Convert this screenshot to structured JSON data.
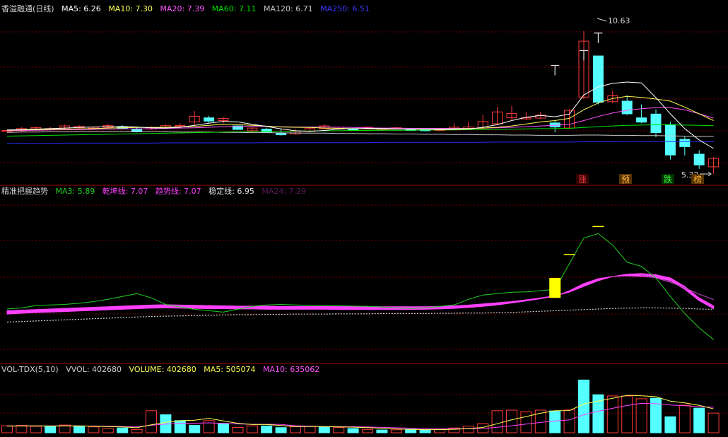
{
  "colors": {
    "up": "#ff3a3a",
    "down": "#54ffff",
    "grid": "#7a0000",
    "divider": "#a00000",
    "ma5": "#ffffff",
    "ma10": "#ffff54",
    "ma20": "#ff54ff",
    "ma60": "#00e400",
    "ma120": "#c8c8c8",
    "ma250": "#2a2aff",
    "white": "#d0d0d0",
    "yellow": "#ffff00",
    "magenta": "#ff40ff",
    "green": "#20d020",
    "purple": "#b040b0"
  },
  "price_header": {
    "name": "香溢融通(日线)",
    "ma5": "MA5: 6.26",
    "ma10": "MA10: 7.30",
    "ma20": "MA20: 7.39",
    "ma60": "MA60: 7.11",
    "ma120": "MA120: 6.71",
    "ma250": "MA250: 6.51"
  },
  "ind_header": {
    "name": "精准把握趋势",
    "ma3": "MA3: 5.89",
    "qk": "乾坤线: 7.07",
    "qs": "趋势线: 7.07",
    "wd": "稳定线: 6.95",
    "ma24": "MA24: 7.29"
  },
  "vol_header": {
    "name": "VOL-TDX(5,10)",
    "vvol": "VVOL: 402680",
    "volume": "VOLUME: 402680",
    "ma5": "MA5: 505074",
    "ma10": "MA10: 635062"
  },
  "annotations": {
    "high_label": "10.63",
    "low_label": "5.32",
    "tag_zhang": "涨",
    "tag_yu": "预",
    "tag_die": "跌",
    "tag_bang": "榜"
  },
  "chart_data": [
    {
      "type": "candlestick",
      "title": "香溢融通(日线)",
      "ylim": [
        5.0,
        11.2
      ],
      "x": [
        1,
        2,
        3,
        4,
        5,
        6,
        7,
        8,
        9,
        10,
        11,
        12,
        13,
        14,
        15,
        16,
        17,
        18,
        19,
        20,
        21,
        22,
        23,
        24,
        25,
        26,
        27,
        28,
        29,
        30,
        31,
        32,
        33,
        34,
        35,
        36,
        37,
        38,
        39,
        40,
        41,
        42,
        43,
        44,
        45,
        46,
        47,
        48,
        49,
        50
      ],
      "open": [
        6.92,
        6.92,
        6.99,
        6.97,
        7.02,
        7.03,
        7.02,
        7.05,
        7.05,
        6.98,
        6.99,
        7.05,
        7.08,
        7.25,
        7.4,
        7.3,
        7.1,
        6.92,
        6.98,
        6.84,
        6.8,
        6.9,
        7.0,
        7.03,
        6.98,
        7.0,
        6.95,
        7.0,
        6.98,
        6.97,
        6.93,
        6.98,
        6.99,
        7.02,
        7.18,
        7.4,
        7.36,
        7.39,
        7.21,
        7.02,
        8.17,
        9.7,
        8.0,
        8.02,
        7.4,
        7.54,
        7.15,
        6.6,
        6.05,
        5.58
      ],
      "close": [
        6.93,
        7.0,
        7.04,
        7.0,
        7.1,
        7.09,
        7.05,
        7.11,
        7.03,
        6.88,
        7.04,
        7.11,
        7.12,
        7.46,
        7.28,
        7.38,
        6.97,
        7.02,
        6.86,
        6.77,
        6.9,
        7.0,
        7.1,
        7.05,
        6.95,
        7.05,
        6.98,
        7.03,
        6.93,
        6.92,
        6.98,
        7.05,
        7.06,
        7.26,
        7.62,
        7.56,
        7.4,
        7.5,
        7.06,
        7.68,
        10.25,
        7.98,
        8.22,
        7.55,
        7.24,
        6.85,
        6.02,
        6.33,
        5.65,
        5.89
      ],
      "high": [
        6.96,
        7.05,
        7.08,
        7.06,
        7.15,
        7.13,
        7.07,
        7.18,
        7.12,
        7.05,
        7.09,
        7.16,
        7.2,
        7.65,
        7.48,
        7.43,
        7.12,
        7.05,
        7.03,
        7.0,
        6.98,
        7.05,
        7.18,
        7.07,
        7.01,
        7.08,
        7.01,
        7.06,
        7.0,
        7.0,
        7.0,
        7.2,
        7.25,
        7.5,
        7.8,
        7.84,
        7.62,
        7.63,
        7.3,
        7.72,
        10.63,
        8.42,
        8.4,
        8.24,
        7.9,
        7.71,
        7.25,
        6.7,
        6.2,
        5.95
      ],
      "low": [
        6.9,
        6.88,
        6.97,
        6.95,
        6.99,
        7.01,
        6.98,
        7.0,
        6.98,
        6.86,
        6.95,
        7.02,
        7.06,
        7.1,
        7.2,
        7.2,
        6.95,
        6.84,
        6.84,
        6.74,
        6.78,
        6.86,
        6.98,
        6.98,
        6.93,
        6.97,
        6.92,
        6.98,
        6.9,
        6.89,
        6.9,
        6.95,
        6.96,
        7.0,
        7.15,
        7.3,
        7.33,
        7.37,
        6.86,
        7.0,
        8.1,
        7.9,
        7.95,
        7.5,
        7.2,
        6.68,
        5.85,
        6.0,
        5.5,
        5.32
      ],
      "ma5": [
        6.95,
        6.96,
        6.98,
        7.0,
        7.02,
        7.04,
        7.06,
        7.07,
        7.08,
        7.06,
        7.03,
        7.02,
        7.05,
        7.12,
        7.2,
        7.27,
        7.25,
        7.16,
        7.08,
        6.99,
        6.92,
        6.9,
        6.93,
        6.98,
        7.0,
        7.01,
        7.0,
        6.99,
        6.98,
        6.98,
        6.96,
        6.97,
        6.98,
        7.05,
        7.15,
        7.3,
        7.42,
        7.49,
        7.44,
        7.54,
        8.25,
        8.55,
        8.68,
        8.73,
        8.7,
        8.15,
        7.55,
        7.0,
        6.58,
        6.26
      ],
      "ma10": [
        6.94,
        6.95,
        6.96,
        6.97,
        6.98,
        6.99,
        7.0,
        7.02,
        7.03,
        7.04,
        7.04,
        7.05,
        7.06,
        7.08,
        7.12,
        7.16,
        7.15,
        7.12,
        7.09,
        7.06,
        7.05,
        7.04,
        7.02,
        7.01,
        7.0,
        6.99,
        6.98,
        6.98,
        6.98,
        6.98,
        6.98,
        6.99,
        7.0,
        7.02,
        7.05,
        7.1,
        7.17,
        7.25,
        7.3,
        7.38,
        7.7,
        7.95,
        8.12,
        8.2,
        8.16,
        8.1,
        8.02,
        7.8,
        7.55,
        7.3
      ],
      "ma20": [
        6.92,
        6.93,
        6.94,
        6.95,
        6.96,
        6.96,
        6.97,
        6.98,
        6.99,
        6.99,
        7.0,
        7.01,
        7.02,
        7.03,
        7.05,
        7.07,
        7.08,
        7.08,
        7.08,
        7.07,
        7.06,
        7.06,
        7.06,
        7.05,
        7.04,
        7.03,
        7.02,
        7.02,
        7.01,
        7.01,
        7.01,
        7.01,
        7.01,
        7.02,
        7.03,
        7.05,
        7.07,
        7.1,
        7.12,
        7.16,
        7.3,
        7.45,
        7.58,
        7.68,
        7.74,
        7.78,
        7.78,
        7.7,
        7.55,
        7.39
      ],
      "ma60": [
        6.72,
        6.73,
        6.74,
        6.75,
        6.76,
        6.77,
        6.78,
        6.79,
        6.8,
        6.81,
        6.82,
        6.83,
        6.84,
        6.85,
        6.86,
        6.87,
        6.88,
        6.89,
        6.9,
        6.9,
        6.91,
        6.91,
        6.92,
        6.92,
        6.93,
        6.93,
        6.94,
        6.94,
        6.94,
        6.95,
        6.95,
        6.95,
        6.96,
        6.96,
        6.97,
        6.98,
        6.99,
        7.0,
        7.0,
        7.01,
        7.04,
        7.07,
        7.1,
        7.12,
        7.13,
        7.14,
        7.14,
        7.13,
        7.12,
        7.11
      ],
      "ma120": [
        6.86,
        6.87,
        6.87,
        6.88,
        6.88,
        6.89,
        6.89,
        6.89,
        6.89,
        6.88,
        6.88,
        6.88,
        6.87,
        6.87,
        6.87,
        6.86,
        6.86,
        6.85,
        6.85,
        6.84,
        6.84,
        6.83,
        6.83,
        6.82,
        6.82,
        6.81,
        6.81,
        6.8,
        6.8,
        6.79,
        6.79,
        6.78,
        6.78,
        6.77,
        6.77,
        6.76,
        6.76,
        6.75,
        6.75,
        6.75,
        6.76,
        6.76,
        6.75,
        6.75,
        6.74,
        6.74,
        6.73,
        6.72,
        6.71,
        6.71
      ],
      "ma250": [
        6.45,
        6.45,
        6.45,
        6.45,
        6.46,
        6.46,
        6.46,
        6.46,
        6.46,
        6.46,
        6.46,
        6.47,
        6.47,
        6.47,
        6.47,
        6.47,
        6.47,
        6.47,
        6.48,
        6.48,
        6.48,
        6.48,
        6.48,
        6.48,
        6.48,
        6.48,
        6.49,
        6.49,
        6.49,
        6.49,
        6.49,
        6.49,
        6.49,
        6.49,
        6.5,
        6.5,
        6.5,
        6.5,
        6.5,
        6.5,
        6.51,
        6.51,
        6.51,
        6.52,
        6.52,
        6.52,
        6.52,
        6.52,
        6.51,
        6.51
      ],
      "markers": [
        {
          "index": 38,
          "value": 9.35
        },
        {
          "index": 40,
          "value": 9.9
        },
        {
          "index": 41,
          "value": 10.55
        }
      ]
    },
    {
      "type": "line",
      "title": "精准把握趋势",
      "ylim": [
        5.2,
        10.8
      ],
      "x": [
        1,
        2,
        3,
        4,
        5,
        6,
        7,
        8,
        9,
        10,
        11,
        12,
        13,
        14,
        15,
        16,
        17,
        18,
        19,
        20,
        21,
        22,
        23,
        24,
        25,
        26,
        27,
        28,
        29,
        30,
        31,
        32,
        33,
        34,
        35,
        36,
        37,
        38,
        39,
        40,
        41,
        42,
        43,
        44,
        45,
        46,
        47,
        48,
        49,
        50
      ],
      "ma3": [
        6.96,
        7.0,
        7.08,
        7.1,
        7.12,
        7.16,
        7.22,
        7.3,
        7.4,
        7.5,
        7.35,
        7.12,
        7.03,
        6.95,
        6.9,
        6.85,
        6.95,
        7.05,
        7.1,
        7.12,
        7.1,
        7.09,
        7.08,
        7.07,
        7.06,
        7.05,
        7.03,
        7.0,
        6.98,
        7.0,
        7.05,
        7.1,
        7.3,
        7.45,
        7.5,
        7.55,
        7.56,
        7.6,
        7.65,
        8.55,
        9.45,
        9.6,
        9.2,
        8.6,
        8.45,
        8.05,
        7.4,
        6.8,
        6.3,
        5.89
      ],
      "qk": [
        6.9,
        6.92,
        6.94,
        6.96,
        6.98,
        7.0,
        7.02,
        7.04,
        7.06,
        7.08,
        7.1,
        7.11,
        7.1,
        7.09,
        7.08,
        7.07,
        7.06,
        7.06,
        7.06,
        7.05,
        7.05,
        7.05,
        7.05,
        7.05,
        7.05,
        7.05,
        7.04,
        7.04,
        7.04,
        7.04,
        7.05,
        7.07,
        7.1,
        7.14,
        7.18,
        7.22,
        7.28,
        7.35,
        7.42,
        7.55,
        7.75,
        7.95,
        8.1,
        8.18,
        8.2,
        8.16,
        8.05,
        7.75,
        7.35,
        7.07
      ],
      "qs": [
        6.88,
        6.91,
        6.93,
        6.95,
        6.97,
        6.99,
        7.01,
        7.03,
        7.05,
        7.07,
        7.09,
        7.1,
        7.09,
        7.08,
        7.07,
        7.07,
        7.06,
        7.06,
        7.05,
        7.05,
        7.05,
        7.05,
        7.05,
        7.04,
        7.04,
        7.04,
        7.04,
        7.04,
        7.04,
        7.05,
        7.06,
        7.08,
        7.11,
        7.15,
        7.2,
        7.27,
        7.34,
        7.42,
        7.5,
        7.7,
        7.95,
        8.12,
        8.2,
        8.22,
        8.2,
        8.16,
        8.05,
        7.75,
        7.35,
        7.07
      ],
      "wd": [
        6.5,
        6.52,
        6.54,
        6.56,
        6.58,
        6.6,
        6.62,
        6.64,
        6.66,
        6.68,
        6.7,
        6.71,
        6.72,
        6.73,
        6.74,
        6.75,
        6.76,
        6.76,
        6.77,
        6.77,
        6.78,
        6.78,
        6.78,
        6.79,
        6.79,
        6.79,
        6.8,
        6.8,
        6.8,
        6.8,
        6.81,
        6.81,
        6.82,
        6.82,
        6.83,
        6.84,
        6.86,
        6.88,
        6.9,
        6.92,
        6.94,
        6.96,
        6.98,
        6.99,
        7.0,
        7.0,
        6.99,
        6.98,
        6.96,
        6.95
      ],
      "ma24": [
        null,
        null,
        null,
        null,
        null,
        null,
        null,
        null,
        null,
        null,
        null,
        null,
        null,
        null,
        null,
        null,
        null,
        null,
        null,
        null,
        null,
        null,
        null,
        null,
        null,
        null,
        null,
        null,
        null,
        null,
        null,
        null,
        null,
        null,
        null,
        null,
        null,
        null,
        null,
        null,
        null,
        null,
        null,
        null,
        8.15,
        8.05,
        7.9,
        7.7,
        7.48,
        7.29
      ],
      "signal_bar": {
        "index": 38,
        "bottom": 7.35,
        "top": 8.05
      },
      "markers": [
        {
          "index": 39,
          "value": 8.87
        },
        {
          "index": 41,
          "value": 9.85
        }
      ]
    },
    {
      "type": "bar",
      "title": "VOL-TDX(5,10)",
      "ylim": [
        0,
        3000000
      ],
      "x": [
        1,
        2,
        3,
        4,
        5,
        6,
        7,
        8,
        9,
        10,
        11,
        12,
        13,
        14,
        15,
        16,
        17,
        18,
        19,
        20,
        21,
        22,
        23,
        24,
        25,
        26,
        27,
        28,
        29,
        30,
        31,
        32,
        33,
        34,
        35,
        36,
        37,
        38,
        39,
        40,
        41,
        42,
        43,
        44,
        45,
        46,
        47,
        48,
        49,
        50
      ],
      "volume": [
        380000,
        400000,
        350000,
        330000,
        420000,
        360000,
        320000,
        230000,
        260000,
        170000,
        1200000,
        980000,
        660000,
        400000,
        660000,
        510000,
        290000,
        380000,
        370000,
        280000,
        330000,
        360000,
        330000,
        280000,
        230000,
        180000,
        150000,
        160000,
        190000,
        170000,
        170000,
        260000,
        360000,
        500000,
        1200000,
        1230000,
        1150000,
        1230000,
        1190000,
        1240000,
        2870000,
        2070000,
        2000000,
        2000000,
        1850000,
        1880000,
        870000,
        1500000,
        1340000,
        1070000
      ],
      "direction": [
        "up",
        "up",
        "up",
        "down",
        "up",
        "down",
        "up",
        "up",
        "down",
        "up",
        "up",
        "down",
        "down",
        "down",
        "up",
        "down",
        "up",
        "up",
        "down",
        "down",
        "up",
        "up",
        "down",
        "up",
        "down",
        "up",
        "down",
        "up",
        "down",
        "down",
        "up",
        "up",
        "up",
        "up",
        "up",
        "up",
        "up",
        "up",
        "down",
        "up",
        "down",
        "down",
        "up",
        "up",
        "up",
        "down",
        "down",
        "up",
        "down",
        "up"
      ],
      "ma5": [
        360000,
        370000,
        375000,
        370000,
        376000,
        372000,
        356000,
        332000,
        318000,
        272000,
        436000,
        566000,
        658000,
        682000,
        784000,
        642000,
        514000,
        448000,
        448000,
        398000,
        336000,
        342000,
        334000,
        316000,
        304000,
        282000,
        246000,
        206000,
        182000,
        170000,
        168000,
        190000,
        232000,
        290000,
        494000,
        706000,
        880000,
        1062000,
        1200000,
        1208000,
        1562000,
        1726000,
        1876000,
        2036000,
        2006000,
        1960000,
        1720000,
        1624000,
        1488000,
        1300000
      ],
      "ma10": [
        370000,
        372000,
        370000,
        368000,
        372000,
        370000,
        366000,
        350000,
        340000,
        320000,
        408000,
        468000,
        510000,
        520000,
        540000,
        510000,
        480000,
        460000,
        460000,
        450000,
        380000,
        360000,
        340000,
        330000,
        325000,
        310000,
        292000,
        270000,
        250000,
        237000,
        226000,
        218000,
        220000,
        230000,
        300000,
        380000,
        470000,
        560000,
        640000,
        700000,
        980000,
        1170000,
        1330000,
        1480000,
        1600000,
        1580000,
        1510000,
        1470000,
        1420000,
        1390000
      ]
    }
  ]
}
